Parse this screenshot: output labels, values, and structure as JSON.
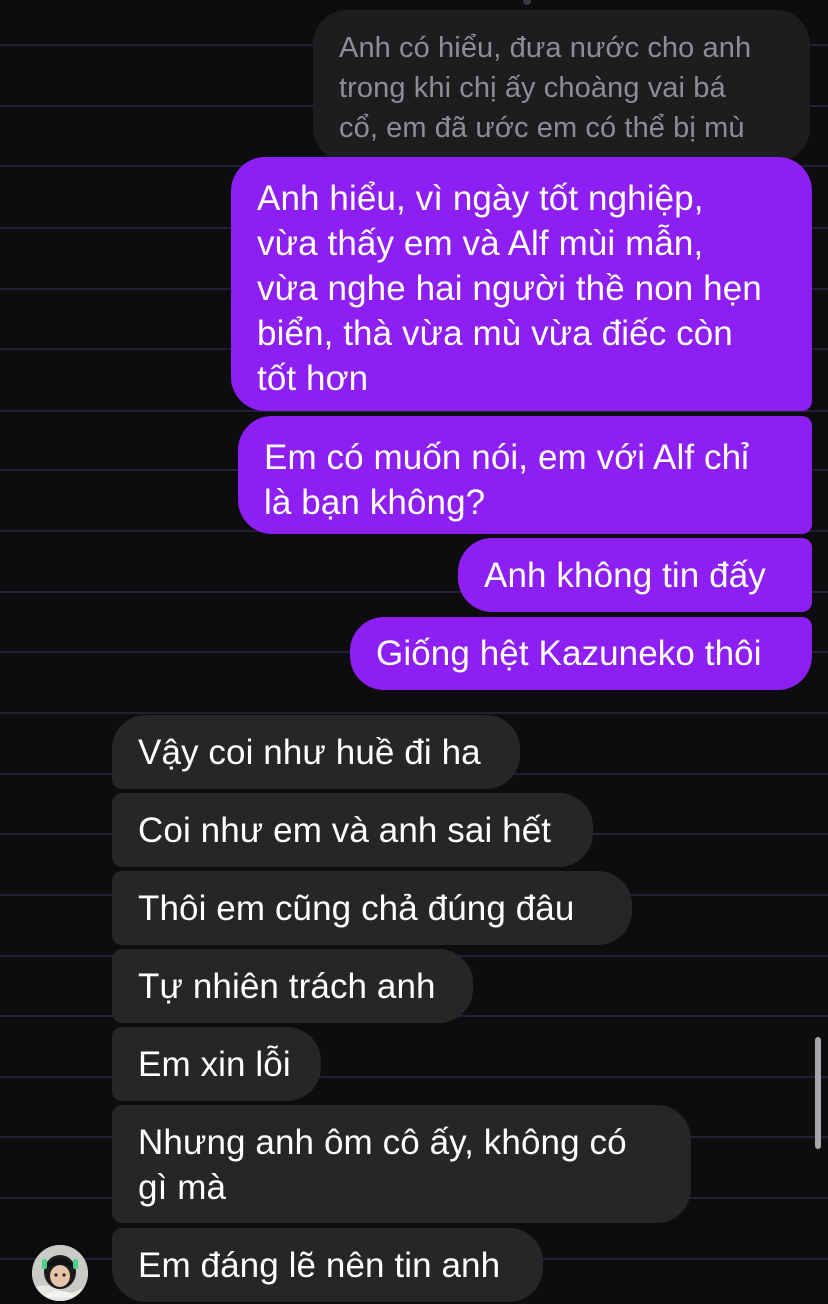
{
  "conversation": {
    "colors": {
      "background": "#0d0d0f",
      "sent_bubble": "#8d1ff3",
      "received_bubble": "#262628",
      "quoted_bubble": "#1d1d20",
      "quoted_text": "#8d8d93",
      "rule_line": "#2a2746"
    },
    "quoted_message": {
      "lines": [
        "Anh có hiểu, đưa nước cho anh",
        "trong khi chị ấy choàng vai bá",
        "cổ, em đã ước em có thể bị mù"
      ]
    },
    "sent_messages": [
      {
        "lines": [
          "Anh hiểu, vì ngày tốt nghiệp,",
          "vừa thấy em và Alf mùi mẫn,",
          "vừa nghe hai người thề non hẹn",
          "biển, thà vừa mù vừa điếc còn",
          "tốt hơn"
        ]
      },
      {
        "lines": [
          "Em có muốn nói, em với Alf chỉ",
          "là bạn không?"
        ]
      },
      {
        "lines": [
          "Anh không tin đấy"
        ]
      },
      {
        "lines": [
          "Giống hệt Kazuneko thôi"
        ]
      }
    ],
    "received_messages": [
      {
        "lines": [
          "Vậy coi như huề đi ha"
        ]
      },
      {
        "lines": [
          "Coi như em và anh sai hết"
        ]
      },
      {
        "lines": [
          "Thôi em cũng chả đúng đâu"
        ]
      },
      {
        "lines": [
          "Tự nhiên trách anh"
        ]
      },
      {
        "lines": [
          "Em xin lỗi"
        ]
      },
      {
        "lines": [
          "Nhưng anh ôm cô ấy, không có",
          "gì mà"
        ]
      },
      {
        "lines": [
          "Em đáng lẽ nên tin anh"
        ]
      }
    ],
    "avatar_icon": "contact-avatar-photo",
    "scrollbar_icon": "vertical-scrollbar"
  }
}
